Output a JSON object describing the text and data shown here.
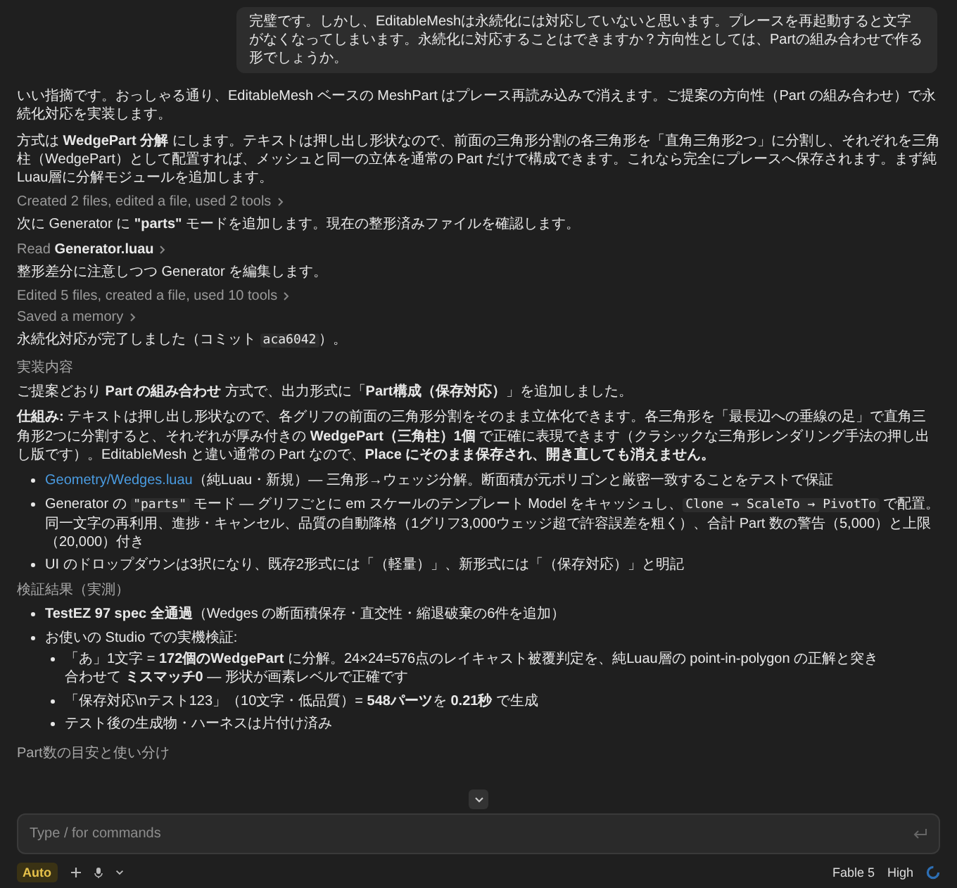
{
  "user_message": {
    "text": "完璧です。しかし、EditableMeshは永続化には対応していないと思います。プレースを再起動すると文字がなくなってしまいます。永続化に対応することはできますか？方向性としては、Partの組み合わせで作る形でしょうか。"
  },
  "blocks": [
    {
      "kind": "paragraph",
      "parts": [
        {
          "kind": "text",
          "text": "いい指摘です。おっしゃる通り、EditableMesh ベースの MeshPart はプレース再読み込みで消えます。ご提案の方向性（Part の組み合わせ）で永続化対応を実装します。"
        }
      ]
    },
    {
      "kind": "paragraph",
      "parts": [
        {
          "kind": "text",
          "text": "方式は **WedgePart 分解** にします。テキストは押し出し形状なので、前面の三角形分割の各三角形を「直角三角形2つ」に分割し、それぞれを三角柱（WedgePart）として配置すれば、メッシュと同一の立体を通常の Part だけで構成できます。これなら完全にプレースへ保存されます。まず純Luau層に分解モジュールを追加します。"
        }
      ]
    },
    {
      "kind": "activity",
      "text": "Created 2 files, edited a file, used 2 tools"
    },
    {
      "kind": "paragraph",
      "parts": [
        {
          "kind": "text",
          "text": "次に Generator に **\"parts\"** モードを追加します。現在の整形済みファイルを確認します。"
        }
      ]
    },
    {
      "kind": "activity",
      "text": "Read **Generator.luau**"
    },
    {
      "kind": "paragraph",
      "parts": [
        {
          "kind": "text",
          "text": "整形差分に注意しつつ Generator を編集します。"
        }
      ]
    },
    {
      "kind": "activity",
      "text": "Edited 5 files, created a file, used 10 tools"
    },
    {
      "kind": "activity",
      "text": "Saved a memory"
    },
    {
      "kind": "paragraph",
      "parts": [
        {
          "kind": "text",
          "text": "永続化対応が完了しました（コミット "
        },
        {
          "kind": "code",
          "text": "aca6042"
        },
        {
          "kind": "text",
          "text": "）。"
        }
      ]
    },
    {
      "kind": "heading",
      "text": "実装内容"
    },
    {
      "kind": "paragraph",
      "parts": [
        {
          "kind": "text",
          "text": "ご提案どおり **Part の組み合わせ** 方式で、出力形式に「**Part構成（保存対応）**」を追加しました。"
        }
      ]
    },
    {
      "kind": "paragraph",
      "parts": [
        {
          "kind": "text",
          "text": "**仕組み:** テキストは押し出し形状なので、各グリフの前面の三角形分割をそのまま立体化できます。各三角形を「最長辺への垂線の足」で直角三角形2つに分割すると、それぞれが厚み付きの **WedgePart（三角柱）1個** で正確に表現できます（クラシックな三角形レンダリング手法の押し出し版です）。EditableMesh と違い通常の Part なので、**Place にそのまま保存され、開き直しても消えません。**"
        }
      ]
    },
    {
      "kind": "bullets",
      "items": [
        {
          "parts": [
            {
              "kind": "link",
              "text": "Geometry/Wedges.luau"
            },
            {
              "kind": "text",
              "text": "（純Luau・新規）— 三角形→ウェッジ分解。断面積が元ポリゴンと厳密一致することをテストで保証"
            }
          ]
        },
        {
          "parts": [
            {
              "kind": "text",
              "text": "Generator の "
            },
            {
              "kind": "code",
              "text": "\"parts\""
            },
            {
              "kind": "text",
              "text": " モード — グリフごとに em スケールのテンプレート Model をキャッシュし、"
            },
            {
              "kind": "code",
              "text": "Clone → ScaleTo → PivotTo"
            },
            {
              "kind": "text",
              "text": " で配置。同一文字の再利用、進捗・キャンセル、品質の自動降格（1グリフ3,000ウェッジ超で許容誤差を粗く）、合計 Part 数の警告（5,000）と上限（20,000）付き"
            }
          ]
        },
        {
          "parts": [
            {
              "kind": "text",
              "text": "UI のドロップダウンは3択になり、既存2形式には「（軽量）」、新形式には「（保存対応）」と明記"
            }
          ]
        }
      ]
    },
    {
      "kind": "heading",
      "text": "検証結果（実測）"
    },
    {
      "kind": "bullets",
      "items": [
        {
          "parts": [
            {
              "kind": "text",
              "text": "**TestEZ 97 spec 全通過**（Wedges の断面積保存・直交性・縮退破棄の6件を追加）"
            }
          ]
        },
        {
          "parts": [
            {
              "kind": "text",
              "text": "お使いの Studio での実機検証:"
            }
          ],
          "children": [
            {
              "parts": [
                {
                  "kind": "text",
                  "text": "「あ」1文字 = **172個のWedgePart** に分解。24×24=576点のレイキャスト被覆判定を、純Luau層の point-in-polygon の正解と突き合わせて **ミスマッチ0** — 形状が画素レベルで正確です"
                }
              ]
            },
            {
              "parts": [
                {
                  "kind": "text",
                  "text": "「保存対応\\nテスト123」（10文字・低品質）= **548パーツ**を **0.21秒** で生成"
                }
              ]
            },
            {
              "parts": [
                {
                  "kind": "text",
                  "text": "テスト後の生成物・ハーネスは片付け済み"
                }
              ]
            }
          ]
        }
      ]
    },
    {
      "kind": "heading",
      "text": "Part数の目安と使い分け"
    }
  ],
  "composer": {
    "placeholder": "Type / for commands"
  },
  "footer": {
    "mode": "Auto",
    "model": "Fable 5",
    "effort": "High"
  }
}
